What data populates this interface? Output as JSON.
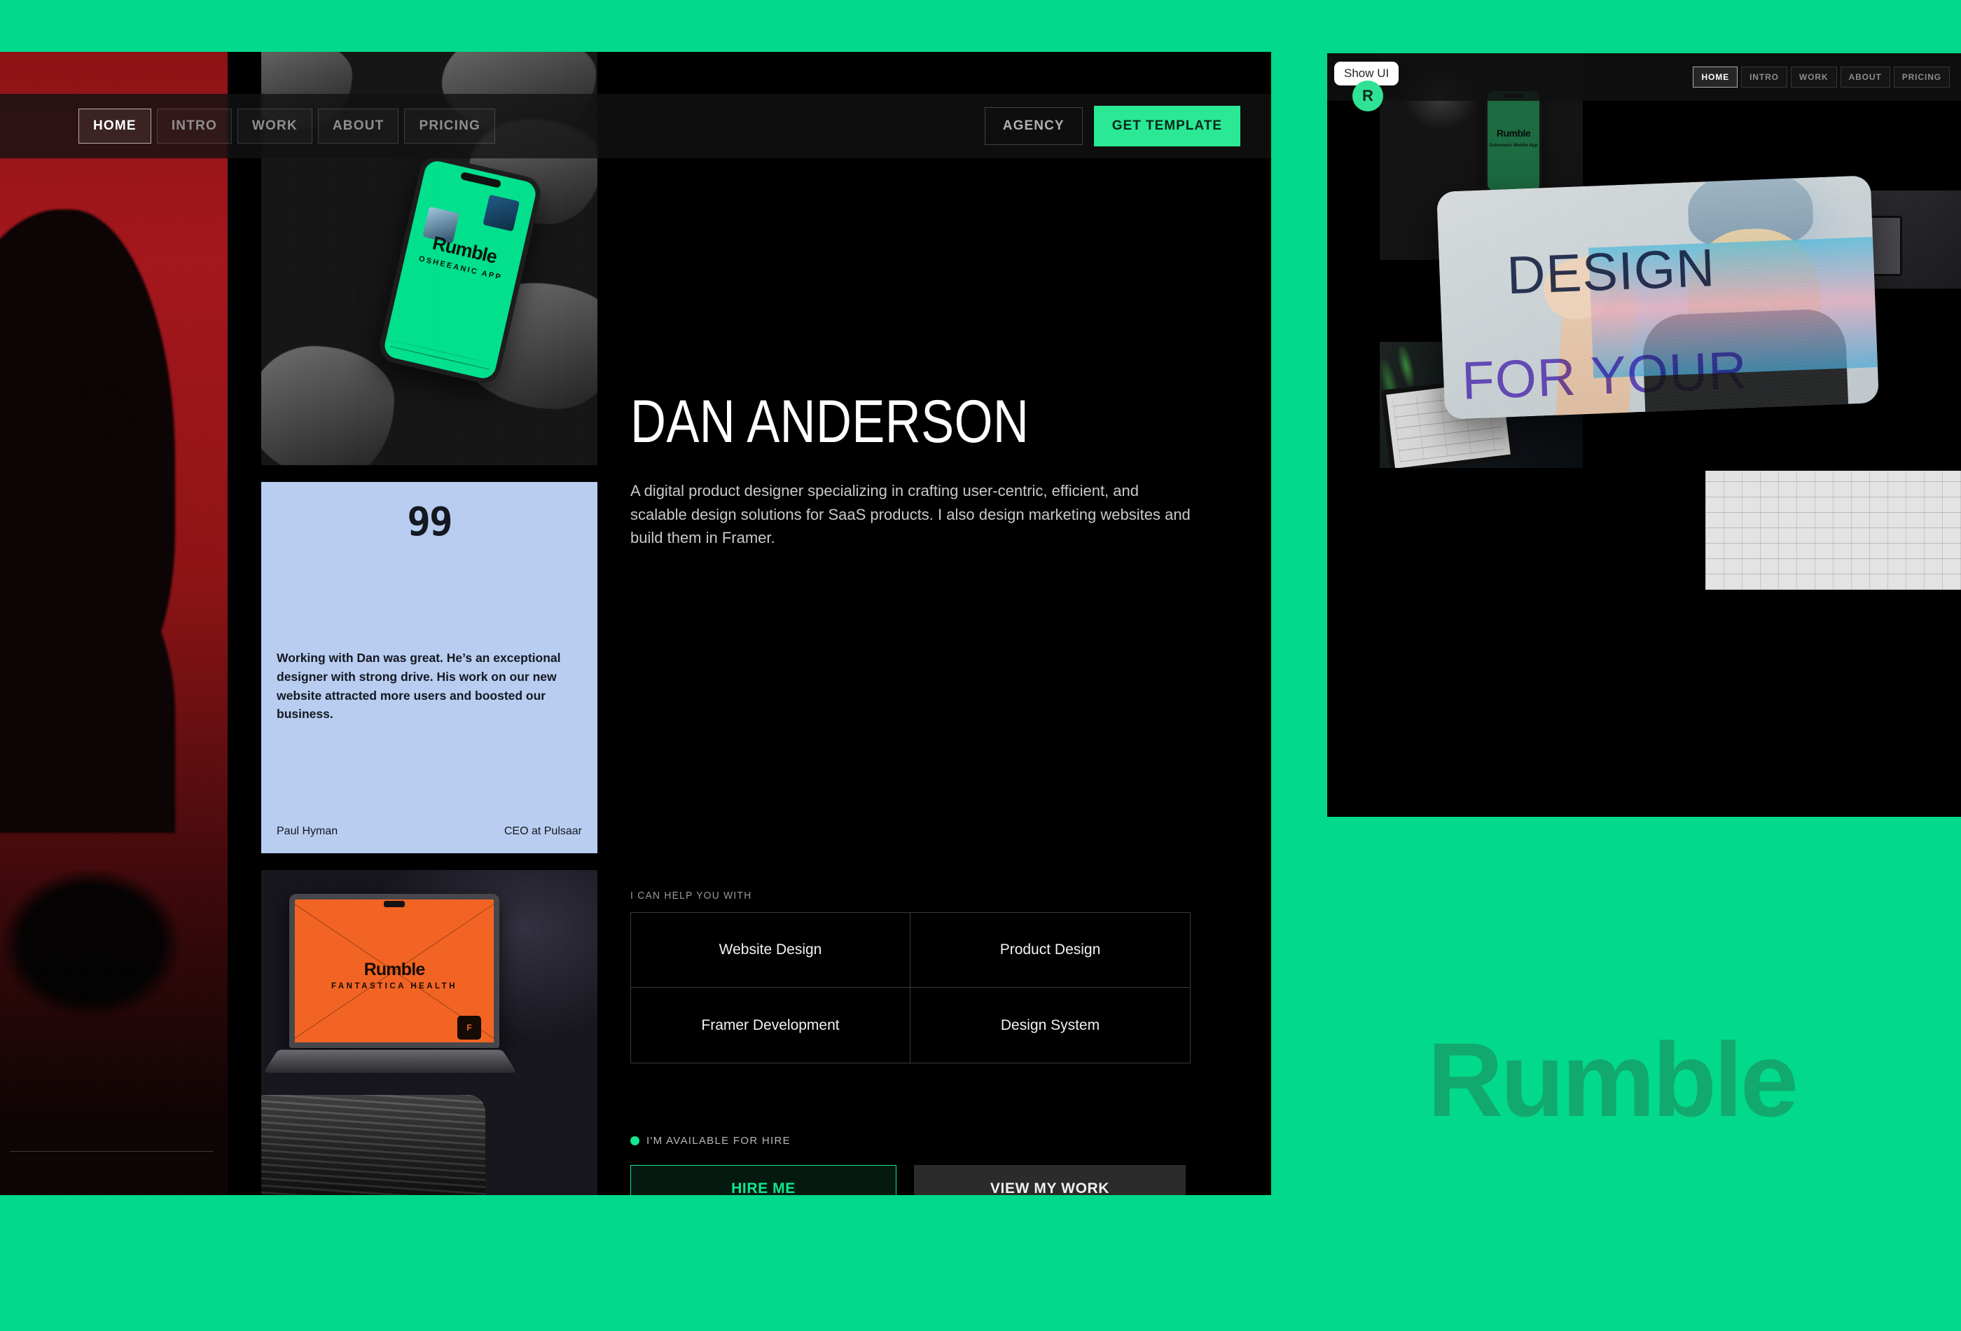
{
  "theme": {
    "background_green": "#02d98c",
    "accent_green": "#2ae894",
    "dark_panel": "#000000",
    "quote_card_blue": "#b9cdf0",
    "brand_mark_green": "#12a96e",
    "red_panel": "#a3151b",
    "laptop_orange": "#f26322"
  },
  "navbar": {
    "items": [
      {
        "label": "HOME",
        "active": true
      },
      {
        "label": "INTRO",
        "active": false
      },
      {
        "label": "WORK",
        "active": false
      },
      {
        "label": "ABOUT",
        "active": false
      },
      {
        "label": "PRICING",
        "active": false
      }
    ],
    "agency_label": "AGENCY",
    "cta_label": "GET TEMPLATE"
  },
  "hero": {
    "title": "DAN ANDERSON",
    "description": "A digital product designer specializing in crafting user-centric, efficient, and scalable design solutions for SaaS products. I also design marketing websites and build them in Framer."
  },
  "services": {
    "label": "I CAN HELP YOU WITH",
    "items": [
      "Website Design",
      "Product Design",
      "Framer Development",
      "Design System"
    ]
  },
  "availability": {
    "status_text": "I'M AVAILABLE FOR HIRE",
    "primary_cta": "HIRE ME",
    "secondary_cta": "VIEW MY WORK"
  },
  "testimonial": {
    "quote_glyph": "99",
    "text": "Working with Dan was great. He’s an exceptional designer with strong drive. His work on our new website attracted more users and boosted our business.",
    "author": "Paul Hyman",
    "role": "CEO at Pulsaar"
  },
  "phone_mockup": {
    "logo": "Rumble",
    "subtitle": "OSHEEANIC APP"
  },
  "laptop_mockup": {
    "logo": "Rumble",
    "subtitle": "FANTASTICA HEALTH",
    "badge": "F"
  },
  "preview": {
    "show_ui_label": "Show UI",
    "badge_letter": "R",
    "nav_items": [
      {
        "label": "HOME",
        "active": true
      },
      {
        "label": "INTRO",
        "active": false
      },
      {
        "label": "WORK",
        "active": false
      },
      {
        "label": "ABOUT",
        "active": false
      },
      {
        "label": "PRICING",
        "active": false
      }
    ],
    "phone_logo": "Rumble",
    "phone_subtitle": "Osheeanic Mobile App",
    "card_label": "Rumble",
    "overlay_line1": "DESIGN",
    "overlay_line2": "FOR YOUR"
  },
  "brand": {
    "wordmark": "Rumble"
  }
}
